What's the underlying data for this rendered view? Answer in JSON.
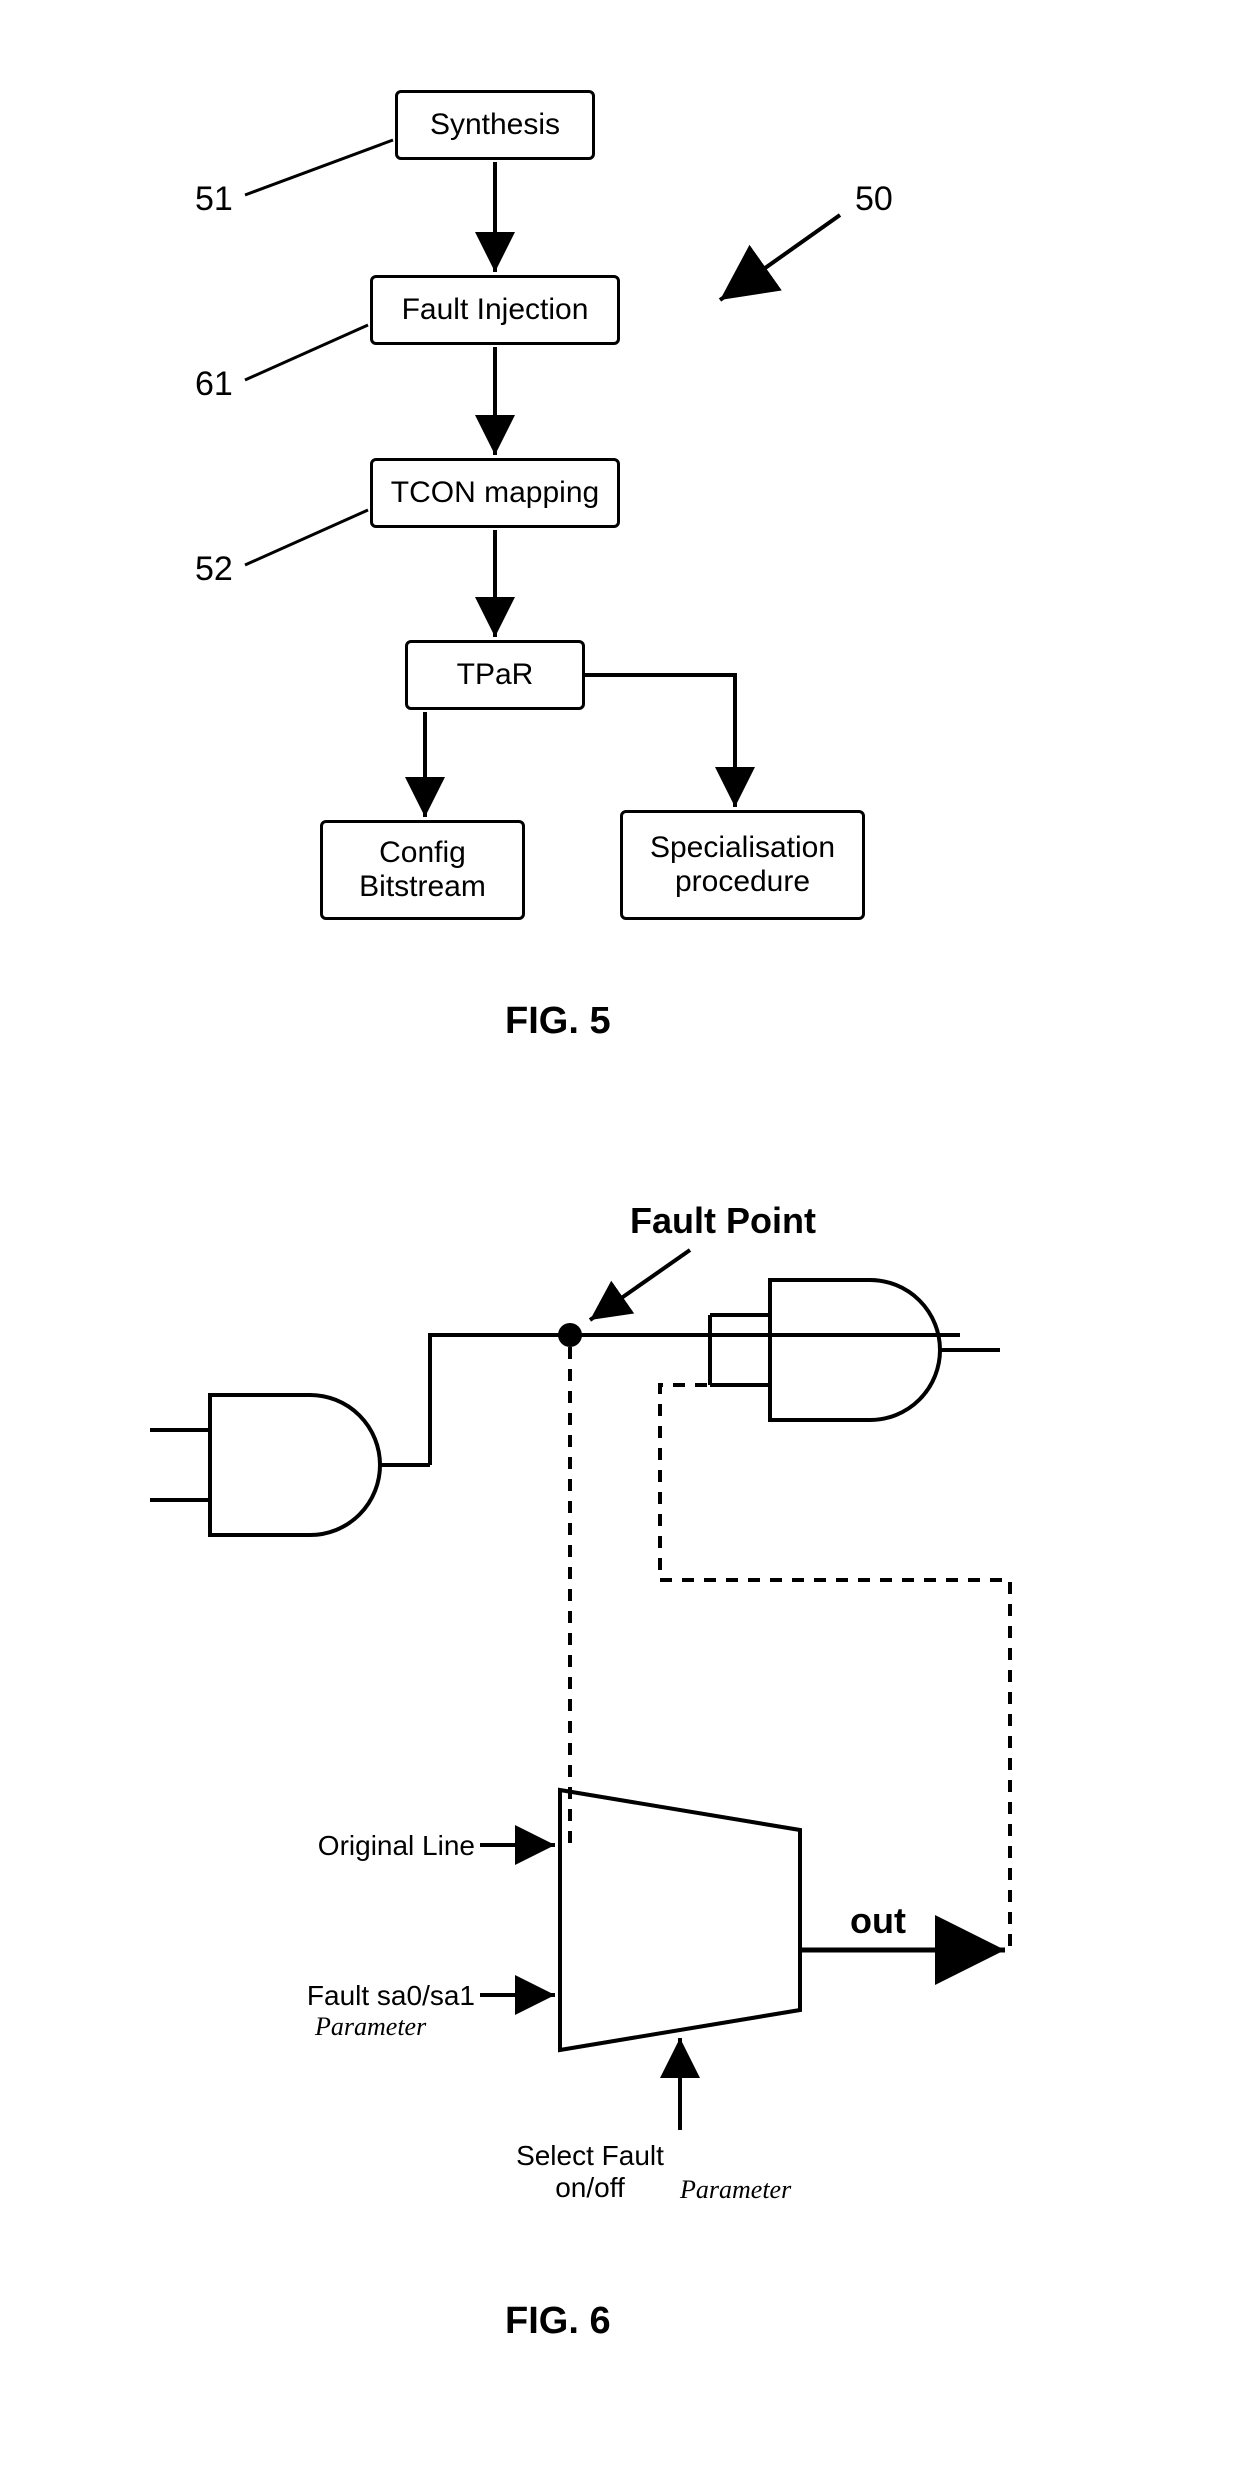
{
  "fig5": {
    "boxes": {
      "synthesis": "Synthesis",
      "fault_injection": "Fault Injection",
      "tcon_mapping": "TCON mapping",
      "tpar": "TPaR",
      "config_bitstream": "Config\nBitstream",
      "specialisation": "Specialisation\nprocedure"
    },
    "labels": {
      "ref50": "50",
      "ref51": "51",
      "ref61": "61",
      "ref52": "52"
    },
    "caption": "FIG. 5"
  },
  "fig6": {
    "labels": {
      "fault_point": "Fault Point",
      "original_line": "Original Line",
      "fault_sa": "Fault sa0/sa1",
      "parameter1": "Parameter",
      "select_fault": "Select Fault\non/off",
      "parameter2": "Parameter",
      "out": "out"
    },
    "caption": "FIG. 6"
  }
}
